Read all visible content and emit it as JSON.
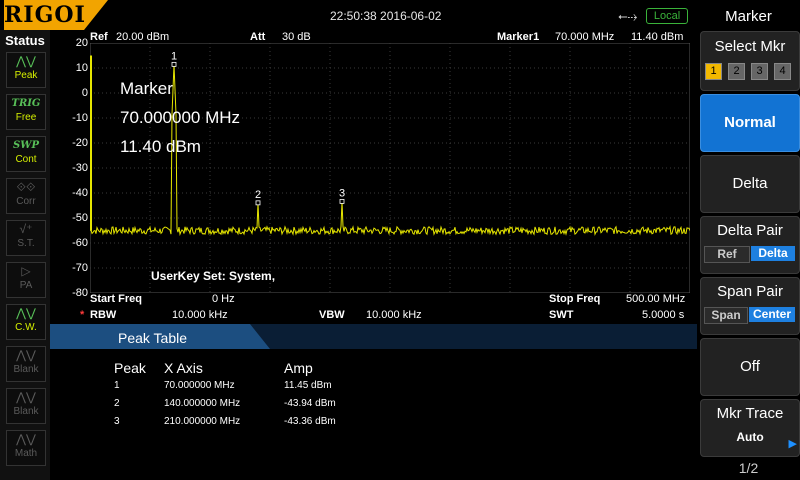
{
  "brand": "RIGOL",
  "datetime": "22:50:38 2016-06-02",
  "local_badge": "Local",
  "status": {
    "title": "Status",
    "items": [
      {
        "icon": "peak-icon",
        "glyph": "⋀⋁",
        "label": "Peak",
        "state": "on"
      },
      {
        "icon": "trig-icon",
        "glyph": "TRIG",
        "label": "Free",
        "state": "on"
      },
      {
        "icon": "swp-icon",
        "glyph": "SWP",
        "label": "Cont",
        "state": "on"
      },
      {
        "icon": "corr-icon",
        "glyph": "⟐⟐",
        "label": "Corr",
        "state": "dim"
      },
      {
        "icon": "st-icon",
        "glyph": "√⁺",
        "label": "S.T.",
        "state": "dim"
      },
      {
        "icon": "pa-icon",
        "glyph": "▷",
        "label": "PA",
        "state": "dim"
      },
      {
        "icon": "cw-icon",
        "glyph": "⋀⋁",
        "label": "C.W.",
        "state": "on"
      },
      {
        "icon": "blank-icon",
        "glyph": "⋀⋁",
        "label": "Blank",
        "state": "dim"
      },
      {
        "icon": "blank-icon",
        "glyph": "⋀⋁",
        "label": "Blank",
        "state": "dim"
      },
      {
        "icon": "math-icon",
        "glyph": "⋀⋁",
        "label": "Math",
        "state": "dim"
      }
    ]
  },
  "header": {
    "ref_label": "Ref",
    "ref_value": "20.00 dBm",
    "att_label": "Att",
    "att_value": "30 dB",
    "marker_label": "Marker1",
    "marker_freq": "70.000 MHz",
    "marker_amp": "11.40 dBm"
  },
  "chart_data": {
    "type": "line",
    "title": "",
    "xlabel": "",
    "ylabel": "",
    "xlim": [
      0,
      500
    ],
    "ylim": [
      -80,
      20
    ],
    "yticks": [
      "20",
      "10",
      "0",
      "-10",
      "-20",
      "-30",
      "-40",
      "-50",
      "-60",
      "-70",
      "-80"
    ],
    "noise_floor_dbm": -55,
    "peaks": [
      {
        "label": "1",
        "x_mhz": 70,
        "y_dbm": 11.45
      },
      {
        "label": "2",
        "x_mhz": 140,
        "y_dbm": -43.94
      },
      {
        "label": "3",
        "x_mhz": 210,
        "y_dbm": -43.36
      }
    ],
    "trace_color": "#e6e600",
    "grid": true
  },
  "marker_box": {
    "title": "Marker",
    "freq": "70.000000 MHz",
    "amp": "11.40 dBm"
  },
  "userkey": "UserKey Set:   System,",
  "bottom": {
    "start_label": "Start Freq",
    "start_value": "0 Hz",
    "stop_label": "Stop Freq",
    "stop_value": "500.00 MHz",
    "rbw_star": "*",
    "rbw_label": "RBW",
    "rbw_value": "10.000 kHz",
    "vbw_label": "VBW",
    "vbw_value": "10.000 kHz",
    "swt_label": "SWT",
    "swt_value": "5.0000 s"
  },
  "peak_table": {
    "title": "Peak Table",
    "headers": [
      "Peak",
      "X Axis",
      "Amp"
    ],
    "rows": [
      [
        "1",
        "70.000000 MHz",
        "11.45 dBm"
      ],
      [
        "2",
        "140.000000 MHz",
        "-43.94 dBm"
      ],
      [
        "3",
        "210.000000 MHz",
        "-43.36 dBm"
      ]
    ]
  },
  "menu": {
    "title": "Marker",
    "select_mkr": "Select Mkr",
    "mkr_numbers": [
      "1",
      "2",
      "3",
      "4"
    ],
    "normal": "Normal",
    "delta": "Delta",
    "delta_pair": "Delta Pair",
    "delta_pair_opts": [
      "Ref",
      "Delta"
    ],
    "span_pair": "Span Pair",
    "span_pair_opts": [
      "Span",
      "Center"
    ],
    "off": "Off",
    "mkr_trace": "Mkr Trace",
    "mkr_trace_value": "Auto",
    "page": "1/2"
  }
}
